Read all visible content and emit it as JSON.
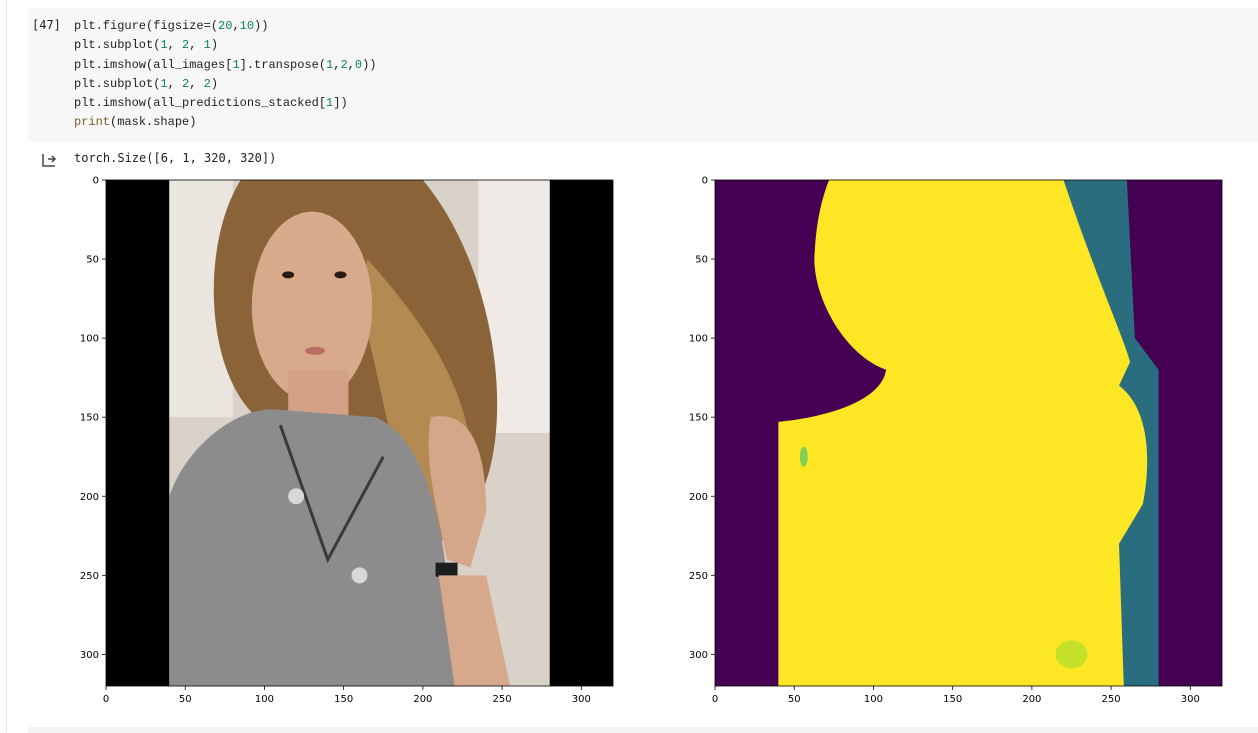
{
  "cell": {
    "execution_count": "[47]",
    "code_lines": [
      [
        {
          "t": "plt.figure(figsize=("
        },
        {
          "t": "20",
          "c": "num"
        },
        {
          "t": ","
        },
        {
          "t": "10",
          "c": "num"
        },
        {
          "t": "))"
        }
      ],
      [
        {
          "t": "plt.subplot("
        },
        {
          "t": "1",
          "c": "num"
        },
        {
          "t": ", "
        },
        {
          "t": "2",
          "c": "num"
        },
        {
          "t": ", "
        },
        {
          "t": "1",
          "c": "num"
        },
        {
          "t": ")"
        }
      ],
      [
        {
          "t": "plt.imshow(all_images["
        },
        {
          "t": "1",
          "c": "num"
        },
        {
          "t": "].transpose("
        },
        {
          "t": "1",
          "c": "num"
        },
        {
          "t": ","
        },
        {
          "t": "2",
          "c": "num"
        },
        {
          "t": ","
        },
        {
          "t": "0",
          "c": "num"
        },
        {
          "t": "))"
        }
      ],
      [
        {
          "t": "plt.subplot("
        },
        {
          "t": "1",
          "c": "num"
        },
        {
          "t": ", "
        },
        {
          "t": "2",
          "c": "num"
        },
        {
          "t": ", "
        },
        {
          "t": "2",
          "c": "num"
        },
        {
          "t": ")"
        }
      ],
      [
        {
          "t": "plt.imshow(all_predictions_stacked["
        },
        {
          "t": "1",
          "c": "num"
        },
        {
          "t": "])"
        }
      ],
      [
        {
          "t": "print",
          "c": "kw"
        },
        {
          "t": "(mask.shape)"
        }
      ]
    ]
  },
  "output": {
    "stdout": "torch.Size([6, 1, 320, 320])"
  },
  "chart_data": [
    {
      "type": "image",
      "content": "photo",
      "xlim": [
        0,
        320
      ],
      "ylim": [
        320,
        0
      ],
      "xticks": [
        0,
        50,
        100,
        150,
        200,
        250,
        300
      ],
      "yticks": [
        0,
        50,
        100,
        150,
        200,
        250,
        300
      ],
      "xtick_labels": [
        "0",
        "50",
        "100",
        "150",
        "200",
        "250",
        "300"
      ],
      "ytick_labels": [
        "0",
        "50",
        "100",
        "150",
        "200",
        "250",
        "300"
      ],
      "padding_left_end": 40,
      "padding_right_start": 280
    },
    {
      "type": "heatmap",
      "colormap": "viridis",
      "xlim": [
        0,
        320
      ],
      "ylim": [
        320,
        0
      ],
      "xticks": [
        0,
        50,
        100,
        150,
        200,
        250,
        300
      ],
      "yticks": [
        0,
        50,
        100,
        150,
        200,
        250,
        300
      ],
      "xtick_labels": [
        "0",
        "50",
        "100",
        "150",
        "200",
        "250",
        "300"
      ],
      "ytick_labels": [
        "0",
        "50",
        "100",
        "150",
        "200",
        "250",
        "300"
      ]
    }
  ],
  "colors": {
    "viridis_low": "#440154",
    "viridis_high": "#fde725",
    "viridis_mid": "#21918c"
  }
}
